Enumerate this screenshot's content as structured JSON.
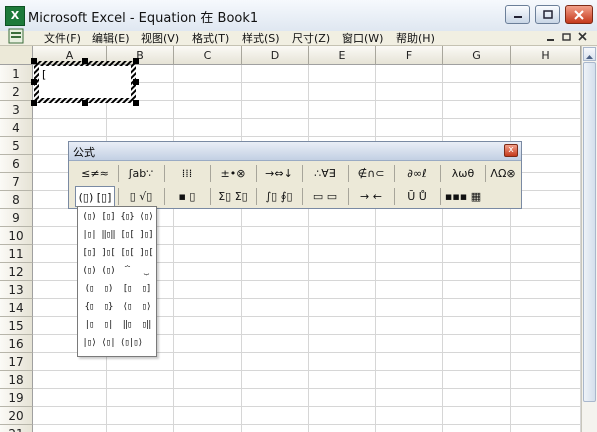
{
  "window": {
    "title": "Microsoft Excel - Equation 在 Book1"
  },
  "menu": [
    {
      "label": "文件(F)"
    },
    {
      "label": "编辑(E)"
    },
    {
      "label": "视图(V)"
    },
    {
      "label": "格式(T)"
    },
    {
      "label": "样式(S)"
    },
    {
      "label": "尺寸(Z)"
    },
    {
      "label": "窗口(W)"
    },
    {
      "label": "帮助(H)"
    }
  ],
  "columns": [
    "A",
    "B",
    "C",
    "D",
    "E",
    "F",
    "G",
    "H"
  ],
  "rows": [
    "1",
    "2",
    "3",
    "4",
    "5",
    "6",
    "7",
    "8",
    "9",
    "10",
    "11",
    "12",
    "13",
    "14",
    "15",
    "16",
    "17",
    "18",
    "19",
    "20",
    "21"
  ],
  "equation_editor": {
    "caret": "["
  },
  "palette": {
    "title": "公式",
    "close_glyph": "x",
    "row1": [
      {
        "label": "≤≠≈"
      },
      {
        "label": "ʃab∵"
      },
      {
        "label": "⁞⁞⁞"
      },
      {
        "label": "±•⊗"
      },
      {
        "label": "→⇔↓"
      },
      {
        "label": "∴∀∃"
      },
      {
        "label": "∉∩⊂"
      },
      {
        "label": "∂∞ℓ"
      },
      {
        "label": "λωθ"
      },
      {
        "label": "ΛΩ⊗"
      }
    ],
    "row2": [
      {
        "label": "(▯) [▯]"
      },
      {
        "label": "▯ √▯"
      },
      {
        "label": "▪ ▯"
      },
      {
        "label": "Σ▯ Σ▯"
      },
      {
        "label": "∫▯ ∮▯"
      },
      {
        "label": "▭ ▭"
      },
      {
        "label": "→ ←"
      },
      {
        "label": "Ū Ů"
      },
      {
        "label": "▪▪▪ ▦"
      }
    ]
  },
  "bracket_templates": [
    "(▯)",
    "[▯]",
    "{▯}",
    "⟨▯⟩",
    "|▯|",
    "‖▯‖",
    "[▯[",
    "]▯]",
    "[▯]",
    "]▯[",
    "[▯[",
    "]▯[",
    "(▯)",
    "(▯)",
    "⏞",
    "⏟",
    "(▯",
    "▯)",
    "[▯",
    "▯]",
    "{▯",
    "▯}",
    "⟨▯",
    "▯⟩",
    "|▯",
    "▯|",
    "‖▯",
    "▯‖",
    "|▯⟩",
    "⟨▯|",
    "⟨▯|▯⟩"
  ]
}
